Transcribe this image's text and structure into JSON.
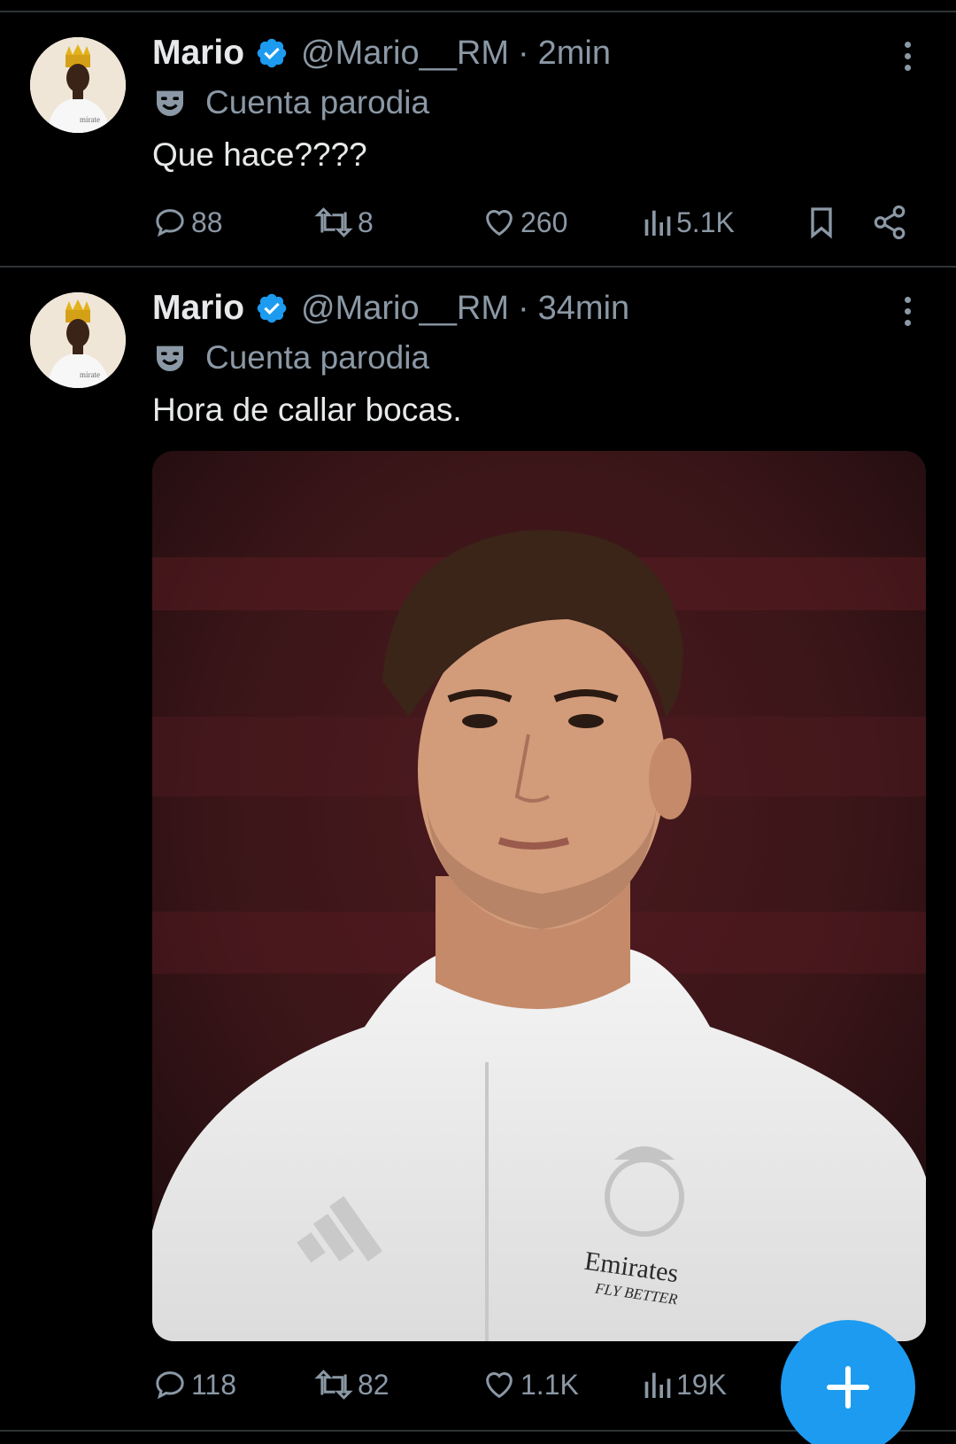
{
  "tweets": [
    {
      "name": "Mario",
      "handle": "@Mario__RM",
      "separator": "·",
      "time": "2min",
      "badge": "Cuenta parodia",
      "text": "Que hace????",
      "replies": "88",
      "retweets": "8",
      "likes": "260",
      "views": "5.1K"
    },
    {
      "name": "Mario",
      "handle": "@Mario__RM",
      "separator": "·",
      "time": "34min",
      "badge": "Cuenta parodia",
      "text": "Hora de callar bocas.",
      "replies": "118",
      "retweets": "82",
      "likes": "1.1K",
      "views": "19K",
      "media": {
        "sponsor": "Emirates",
        "sponsor_tagline": "FLY BETTER"
      }
    }
  ],
  "icons": {
    "verified": "verified-badge-icon",
    "parody": "theater-mask-icon",
    "reply": "reply-icon",
    "retweet": "retweet-icon",
    "like": "heart-icon",
    "views": "views-icon",
    "bookmark": "bookmark-icon",
    "share": "share-icon",
    "more": "more-options-icon",
    "compose": "plus-icon"
  },
  "colors": {
    "background": "#000000",
    "text": "#e7e9ea",
    "secondary": "#8b98a5",
    "accent": "#1d9bf0",
    "divider": "#2f3336"
  }
}
